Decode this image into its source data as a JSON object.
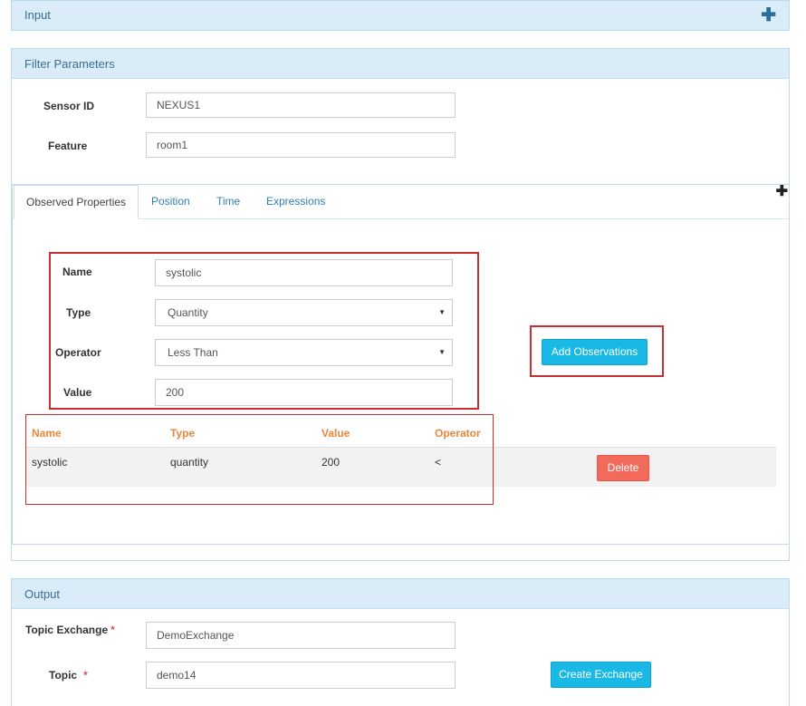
{
  "input_panel": {
    "title": "Input"
  },
  "filter_panel": {
    "title": "Filter Parameters",
    "sensor_id": {
      "label": "Sensor ID",
      "value": "NEXUS1"
    },
    "feature": {
      "label": "Feature",
      "value": "room1"
    }
  },
  "tabs": [
    {
      "label": "Observed Properties"
    },
    {
      "label": "Position"
    },
    {
      "label": "Time"
    },
    {
      "label": "Expressions"
    }
  ],
  "observation_form": {
    "name": {
      "label": "Name",
      "value": "systolic"
    },
    "type": {
      "label": "Type",
      "value": "Quantity"
    },
    "operator": {
      "label": "Operator",
      "value": "Less Than"
    },
    "value": {
      "label": "Value",
      "value": "200"
    },
    "add_label": "Add Observations"
  },
  "table": {
    "headers": [
      "Name",
      "Type",
      "Value",
      "Operator"
    ],
    "rows": [
      {
        "name": "systolic",
        "type": "quantity",
        "value": "200",
        "operator": "<",
        "action": "Delete"
      }
    ]
  },
  "output_panel": {
    "title": "Output",
    "topic_exchange": {
      "label": "Topic Exchange",
      "value": "DemoExchange"
    },
    "topic": {
      "label": "Topic",
      "value": "demo14"
    },
    "required_mark": "*",
    "create_label": "Create Exchange"
  },
  "icons": {
    "expand": "plus-icon",
    "dropdown": "caret-down-icon"
  }
}
